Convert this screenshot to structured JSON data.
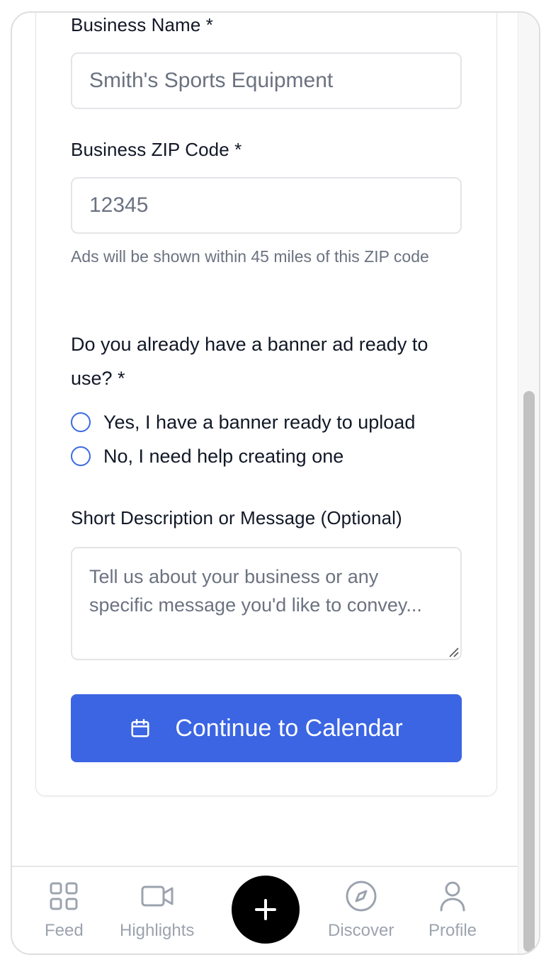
{
  "form": {
    "business_name": {
      "label": "Business Name *",
      "placeholder": "Smith's Sports Equipment",
      "value": ""
    },
    "business_zip": {
      "label": "Business ZIP Code *",
      "placeholder": "12345",
      "value": "",
      "hint": "Ads will be shown within 45 miles of this ZIP code"
    },
    "banner_question": {
      "label": "Do you already have a banner ad ready to use? *",
      "options": [
        {
          "label": "Yes, I have a banner ready to upload",
          "selected": false
        },
        {
          "label": "No, I need help creating one",
          "selected": false
        }
      ]
    },
    "description": {
      "label": "Short Description or Message (Optional)",
      "placeholder": "Tell us about your business or any specific message you'd like to convey...",
      "value": ""
    },
    "submit": {
      "label": "Continue to Calendar",
      "icon": "calendar-icon"
    }
  },
  "bottom_nav": {
    "items": [
      {
        "label": "Feed",
        "icon": "grid-icon"
      },
      {
        "label": "Highlights",
        "icon": "video-camera-icon"
      },
      {
        "label": "",
        "icon": "plus-icon"
      },
      {
        "label": "Discover",
        "icon": "compass-icon"
      },
      {
        "label": "Profile",
        "icon": "user-icon"
      }
    ]
  },
  "colors": {
    "primary": "#3b65e3",
    "radio_border": "#3b6ae3",
    "nav_inactive": "#9ca3af",
    "fab": "#000000"
  }
}
